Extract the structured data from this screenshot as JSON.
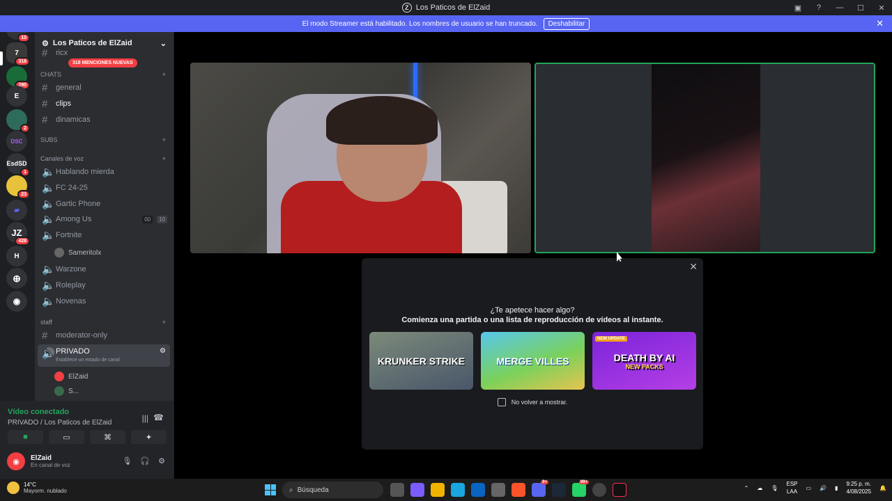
{
  "window": {
    "title": "Los Paticos de ElZaid"
  },
  "banner": {
    "text": "El modo Streamer está habilitado. Los nombres de usuario se han truncado.",
    "button": "Deshabilitar"
  },
  "guilds": [
    {
      "label": "",
      "badge": "10"
    },
    {
      "label": "7",
      "badge": "318"
    },
    {
      "label": "",
      "badge": "290"
    },
    {
      "label": "E",
      "badge": ""
    },
    {
      "label": "",
      "badge": "2"
    },
    {
      "label": "DSC",
      "badge": ""
    },
    {
      "label": "EsdSD",
      "badge": "1"
    },
    {
      "label": "",
      "badge": "23"
    },
    {
      "label": "",
      "badge": ""
    },
    {
      "label": "JZ",
      "badge": "428"
    },
    {
      "label": "H",
      "badge": ""
    }
  ],
  "server": {
    "name": "Los Paticos de ElZaid",
    "mentions": "318 MENCIONES NUEVAS",
    "clipped_item": "ricx"
  },
  "categories": {
    "chats": "CHATS",
    "subs": "SUBS",
    "voice": "Canales de voz",
    "staff": "staff"
  },
  "text_channels": [
    {
      "name": "general"
    },
    {
      "name": "clips"
    },
    {
      "name": "dinamicas"
    }
  ],
  "voice_channels": [
    {
      "name": "Hablando mierda"
    },
    {
      "name": "FC 24-25"
    },
    {
      "name": "Gartic Phone"
    },
    {
      "name": "Among Us",
      "count_a": "00",
      "count_b": "10"
    },
    {
      "name": "Fortnite"
    }
  ],
  "fortnite_user": "Sameritolx",
  "voice_channels_2": [
    {
      "name": "Warzone"
    },
    {
      "name": "Roleplay"
    },
    {
      "name": "Novenas"
    }
  ],
  "staff_channel": "moderator-only",
  "private": {
    "name": "PRIVADO",
    "status": "Establece un estado de canal",
    "users": [
      "ElZaid",
      "S..."
    ]
  },
  "voice_panel": {
    "status": "Vídeo conectado",
    "location": "PRIVADO / Los Paticos de ElZaid"
  },
  "me": {
    "name": "ElZaid",
    "status": "En canal de voz"
  },
  "modal": {
    "question": "¿Te apetece hacer algo?",
    "subtitle": "Comienza una partida o una lista de reproducción de vídeos al instante.",
    "activities": [
      "KRUNKER STRIKE",
      "MERGE VILLES",
      "DEATH BY AI"
    ],
    "activity3_tag": "NEW UPDATE",
    "activity3_sub": "NEW PACKS",
    "checkbox": "No volver a mostrar."
  },
  "taskbar": {
    "temp": "14°C",
    "weather": "Mayorm. nublado",
    "search": "Búsqueda",
    "lang1": "ESP",
    "lang2": "LAA",
    "time": "9:25 p. m.",
    "date": "4/08/2025",
    "badge_discord": "9+",
    "badge_whatsapp": "99+"
  },
  "colors": {
    "accent": "#5865f2",
    "online": "#23a55a",
    "danger": "#f23f43"
  }
}
